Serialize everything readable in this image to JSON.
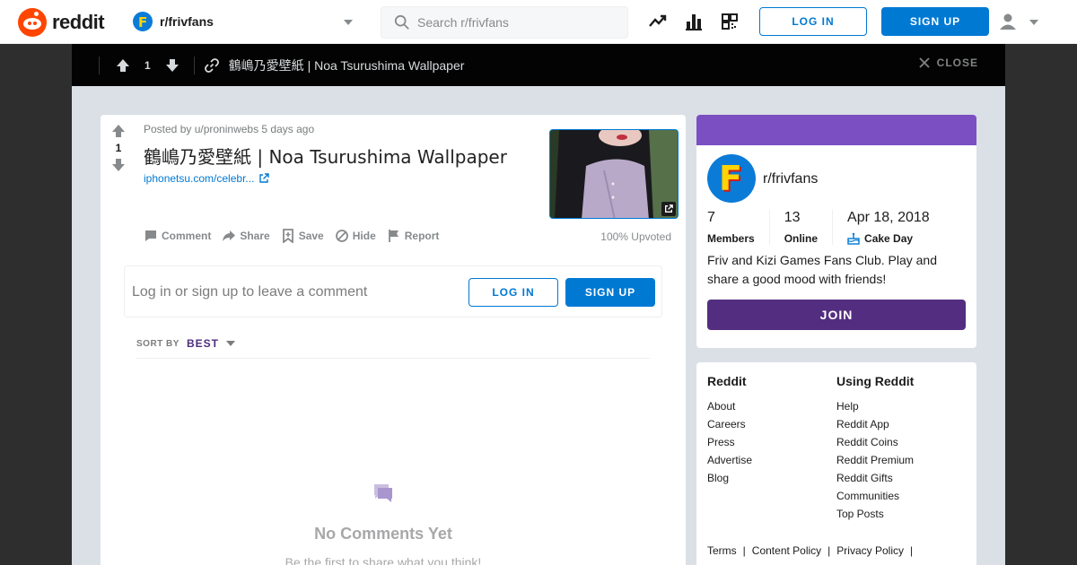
{
  "brand": {
    "name": "reddit",
    "accent": "#ff4500"
  },
  "header": {
    "subreddit": "r/frivfans",
    "search_placeholder": "Search r/frivfans",
    "login_label": "LOG IN",
    "signup_label": "SIGN UP"
  },
  "post_bar": {
    "vote_count": "1",
    "title": "鶴嶋乃愛壁紙 | Noa Tsurushima Wallpaper",
    "close_label": "CLOSE"
  },
  "post": {
    "vote_count": "1",
    "posted_by": "Posted by u/proninwebs 5 days ago",
    "title": "鶴嶋乃愛壁紙 | Noa Tsurushima Wallpaper",
    "link_text": "iphonetsu.com/celebr...",
    "actions": {
      "comment": "Comment",
      "share": "Share",
      "save": "Save",
      "hide": "Hide",
      "report": "Report"
    },
    "upvoted": "100% Upvoted"
  },
  "comment_prompt": {
    "text": "Log in or sign up to leave a comment",
    "login_label": "LOG IN",
    "signup_label": "SIGN UP"
  },
  "sort": {
    "label": "SORT BY",
    "value": "BEST"
  },
  "empty_state": {
    "title": "No Comments Yet",
    "subtitle": "Be the first to share what you think!"
  },
  "about": {
    "name": "r/frivfans",
    "members_value": "7",
    "members_label": "Members",
    "online_value": "13",
    "online_label": "Online",
    "cake_value": "Apr 18, 2018",
    "cake_label": "Cake Day",
    "description": "Friv and Kizi Games Fans Club. Play and share a good mood with friends!",
    "join_label": "JOIN",
    "header_color": "#7b4fc2"
  },
  "links": {
    "col1_head": "Reddit",
    "col1": [
      "About",
      "Careers",
      "Press",
      "Advertise",
      "Blog"
    ],
    "col2_head": "Using Reddit",
    "col2": [
      "Help",
      "Reddit App",
      "Reddit Coins",
      "Reddit Premium",
      "Reddit Gifts",
      "Communities",
      "Top Posts"
    ],
    "footer": [
      "Terms",
      "Content Policy",
      "Privacy Policy"
    ]
  }
}
